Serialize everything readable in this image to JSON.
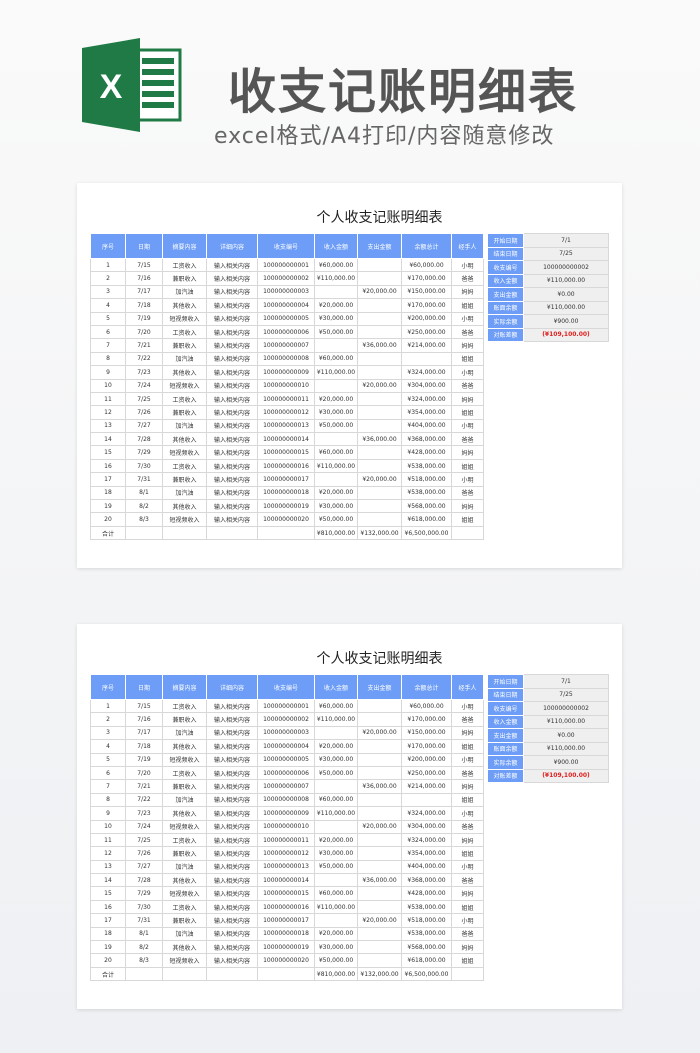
{
  "header": {
    "title": "收支记账明细表",
    "subtitle": "excel格式/A4打印/内容随意修改",
    "logo_letter": "X"
  },
  "colors": {
    "header_blue": "#6d9df6",
    "excel_green": "#1f7a45",
    "negative_red": "#e0201e"
  },
  "sheet": {
    "title": "个人收支记账明细表",
    "columns": [
      "序号",
      "日期",
      "摘要内容",
      "详细内容",
      "收支编号",
      "收入金额",
      "支出金额",
      "余额总计",
      "经手人"
    ],
    "rows": [
      [
        "1",
        "7/15",
        "工资收入",
        "输入相关内容",
        "100000000001",
        "¥60,000.00",
        "",
        "¥60,000.00",
        "小明"
      ],
      [
        "2",
        "7/16",
        "兼职收入",
        "输入相关内容",
        "100000000002",
        "¥110,000.00",
        "",
        "¥170,000.00",
        "爸爸"
      ],
      [
        "3",
        "7/17",
        "加汽油",
        "输入相关内容",
        "100000000003",
        "",
        "¥20,000.00",
        "¥150,000.00",
        "妈妈"
      ],
      [
        "4",
        "7/18",
        "其他收入",
        "输入相关内容",
        "100000000004",
        "¥20,000.00",
        "",
        "¥170,000.00",
        "姐姐"
      ],
      [
        "5",
        "7/19",
        "短视频收入",
        "输入相关内容",
        "100000000005",
        "¥30,000.00",
        "",
        "¥200,000.00",
        "小明"
      ],
      [
        "6",
        "7/20",
        "工资收入",
        "输入相关内容",
        "100000000006",
        "¥50,000.00",
        "",
        "¥250,000.00",
        "爸爸"
      ],
      [
        "7",
        "7/21",
        "兼职收入",
        "输入相关内容",
        "100000000007",
        "",
        "¥36,000.00",
        "¥214,000.00",
        "妈妈"
      ],
      [
        "8",
        "7/22",
        "加汽油",
        "输入相关内容",
        "100000000008",
        "¥60,000.00",
        "",
        "",
        "姐姐"
      ],
      [
        "9",
        "7/23",
        "其他收入",
        "输入相关内容",
        "100000000009",
        "¥110,000.00",
        "",
        "¥324,000.00",
        "小明"
      ],
      [
        "10",
        "7/24",
        "短视频收入",
        "输入相关内容",
        "100000000010",
        "",
        "¥20,000.00",
        "¥304,000.00",
        "爸爸"
      ],
      [
        "11",
        "7/25",
        "工资收入",
        "输入相关内容",
        "100000000011",
        "¥20,000.00",
        "",
        "¥324,000.00",
        "妈妈"
      ],
      [
        "12",
        "7/26",
        "兼职收入",
        "输入相关内容",
        "100000000012",
        "¥30,000.00",
        "",
        "¥354,000.00",
        "姐姐"
      ],
      [
        "13",
        "7/27",
        "加汽油",
        "输入相关内容",
        "100000000013",
        "¥50,000.00",
        "",
        "¥404,000.00",
        "小明"
      ],
      [
        "14",
        "7/28",
        "其他收入",
        "输入相关内容",
        "100000000014",
        "",
        "¥36,000.00",
        "¥368,000.00",
        "爸爸"
      ],
      [
        "15",
        "7/29",
        "短视频收入",
        "输入相关内容",
        "100000000015",
        "¥60,000.00",
        "",
        "¥428,000.00",
        "妈妈"
      ],
      [
        "16",
        "7/30",
        "工资收入",
        "输入相关内容",
        "100000000016",
        "¥110,000.00",
        "",
        "¥538,000.00",
        "姐姐"
      ],
      [
        "17",
        "7/31",
        "兼职收入",
        "输入相关内容",
        "100000000017",
        "",
        "¥20,000.00",
        "¥518,000.00",
        "小明"
      ],
      [
        "18",
        "8/1",
        "加汽油",
        "输入相关内容",
        "100000000018",
        "¥20,000.00",
        "",
        "¥538,000.00",
        "爸爸"
      ],
      [
        "19",
        "8/2",
        "其他收入",
        "输入相关内容",
        "100000000019",
        "¥30,000.00",
        "",
        "¥568,000.00",
        "妈妈"
      ],
      [
        "20",
        "8/3",
        "短视频收入",
        "输入相关内容",
        "100000000020",
        "¥50,000.00",
        "",
        "¥618,000.00",
        "姐姐"
      ]
    ],
    "total": [
      "合计",
      "",
      "",
      "",
      "",
      "¥810,000.00",
      "¥132,000.00",
      "¥6,500,000.00",
      ""
    ],
    "summary": [
      {
        "label": "开始日期",
        "value": "7/1"
      },
      {
        "label": "结束日期",
        "value": "7/25"
      },
      {
        "label": "收支编号",
        "value": "100000000002"
      },
      {
        "label": "收入金额",
        "value": "¥110,000.00"
      },
      {
        "label": "支出金额",
        "value": "¥0.00"
      },
      {
        "label": "账面余额",
        "value": "¥110,000.00"
      },
      {
        "label": "实际余额",
        "value": "¥900.00"
      },
      {
        "label": "对账差额",
        "value": "(¥109,100.00)"
      }
    ]
  }
}
